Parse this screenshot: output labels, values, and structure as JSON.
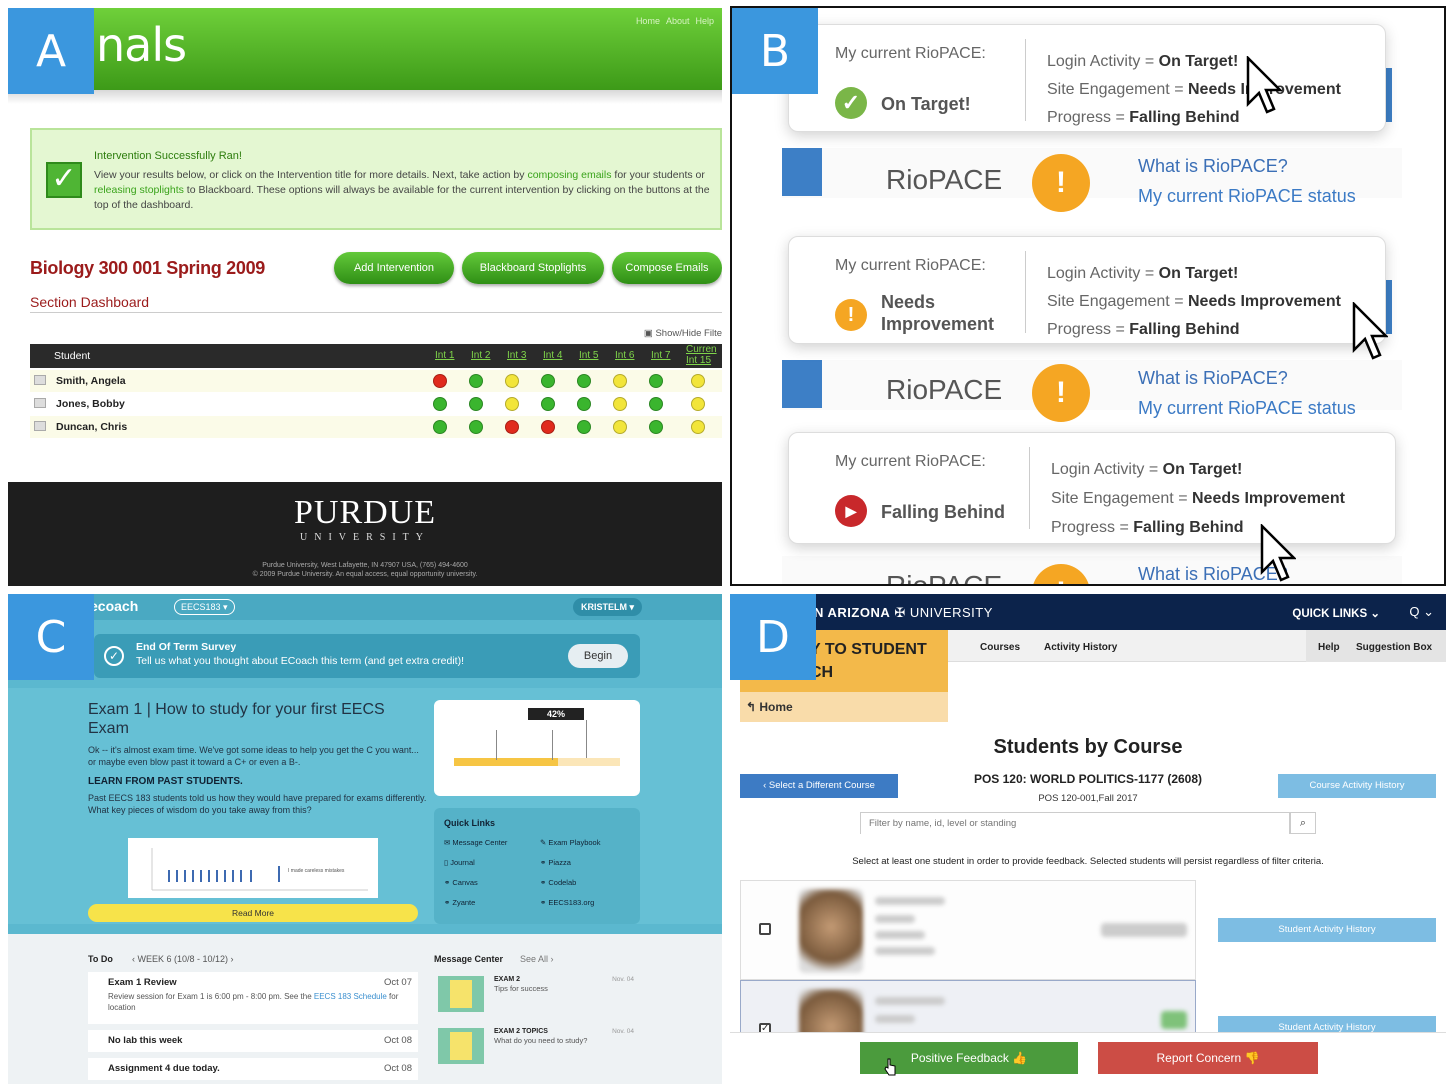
{
  "panel_labels": {
    "a": "A",
    "b": "B",
    "c": "C",
    "d": "D"
  },
  "panel_a": {
    "logo": "nals",
    "topnav": [
      "Home",
      "About",
      "Help"
    ],
    "notice_title": "Intervention Successfully Ran!",
    "notice_pre1": "View your results below, or click on the Intervention title for more details. Next, take action by ",
    "notice_link1": "composing emails",
    "notice_mid": " for your students or ",
    "notice_link2": "releasing stoplights",
    "notice_post": " to Blackboard. These options will always be available for the current intervention by clicking on the buttons at the top of the dashboard.",
    "course_title": "Biology 300 001 Spring 2009",
    "buttons": [
      "Add Intervention",
      "Blackboard Stoplights",
      "Compose Emails"
    ],
    "section": "Section Dashboard",
    "show_hide": "Show/Hide Filte",
    "table_header_student": "Student",
    "interventions": [
      "Int 1",
      "Int 2",
      "Int 3",
      "Int 4",
      "Int 5",
      "Int 6",
      "Int 7"
    ],
    "current_col": [
      "Curren",
      "Int 15"
    ],
    "students": [
      {
        "name": "Smith, Angela",
        "lights": [
          "red",
          "green",
          "yellow",
          "green",
          "green",
          "yellow",
          "green",
          "yellow"
        ]
      },
      {
        "name": "Jones, Bobby",
        "lights": [
          "green",
          "green",
          "yellow",
          "green",
          "green",
          "yellow",
          "green",
          "yellow"
        ]
      },
      {
        "name": "Duncan, Chris",
        "lights": [
          "green",
          "green",
          "red",
          "red",
          "green",
          "yellow",
          "green",
          "yellow"
        ]
      }
    ],
    "footer_logo": "PURDUE",
    "footer_univ": "UNIVERSITY",
    "footer_line1": "Purdue University, West Lafayette, IN 47907 USA, (765) 494-4600",
    "footer_line2": "© 2009 Purdue University. An equal access, equal opportunity university.",
    "colors": {
      "red": "#e02a1d",
      "green": "#3ab52e",
      "yellow": "#f2e53a"
    }
  },
  "panel_b": {
    "current_label": "My current RioPACE:",
    "bg_title": "RioPACE",
    "bg_what": "What is RioPACE?",
    "bg_status": "My current RioPACE status",
    "cards": [
      {
        "status": "On Target!",
        "icon": "check-icon",
        "login_l": "Login Activity = ",
        "login_v": "On Target!",
        "eng_l": "Site Engagement = ",
        "eng_v": "Needs Improvement",
        "prog_l": "Progress = ",
        "prog_v": "Falling Behind"
      },
      {
        "status": "Needs Improvement",
        "status_l1": "Needs",
        "status_l2": "Improvement",
        "icon": "warning-icon",
        "login_l": "Login Activity = ",
        "login_v": "On Target!",
        "eng_l": "Site Engagement = ",
        "eng_v": "Needs Improvement",
        "prog_l": "Progress = ",
        "prog_v": "Falling Behind"
      },
      {
        "status": "Falling Behind",
        "icon": "play-icon",
        "login_l": "Login Activity = ",
        "login_v": "On Target!",
        "eng_l": "Site Engagement = ",
        "eng_v": "Needs Improvement",
        "prog_l": "Progress = ",
        "prog_v": "Falling Behind"
      }
    ],
    "colors": {
      "on_target": "#7ab648",
      "needs_improvement": "#f5a623",
      "falling_behind": "#c8282b"
    }
  },
  "panel_c": {
    "brand": "ecoach",
    "course_badge": "EECS183 ▾",
    "user_badge": "KRISTELM ▾",
    "survey_title": "End Of Term Survey",
    "survey_body": "Tell us what you thought about ECoach this term (and get extra credit)!",
    "begin": "Begin",
    "exam_title": "Exam 1 | How to study for your first EECS Exam",
    "intro": "Ok -- it's almost exam time. We've got some ideas to help you get the C you want... or maybe even blow past it toward a C+ or even a B-.",
    "learn_title": "LEARN FROM PAST STUDENTS.",
    "learn_body": "Past EECS 183 students told us how they would have prepared for exams differently. What key pieces of wisdom do you take away from this?",
    "chart_caption": "I made careless mistakes",
    "read_more": "Read More",
    "grade_pct": "42%",
    "quick_links_title": "Quick Links",
    "quick_links": [
      "Message Center",
      "Exam Playbook",
      "Journal",
      "Piazza",
      "Canvas",
      "Codelab",
      "Zyante",
      "EECS183.org"
    ],
    "todo_title": "To Do",
    "week": "‹  WEEK 6 (10/8 - 10/12) ›",
    "todos": [
      {
        "title": "Exam 1 Review",
        "date": "Oct 07",
        "desc_pre": "Review session for Exam 1 is 6:00 pm - 8:00 pm. See the ",
        "desc_link": "EECS 183 Schedule",
        "desc_post": " for location"
      },
      {
        "title": "No lab this week",
        "date": "Oct 08"
      },
      {
        "title": "Assignment 4 due today.",
        "date": "Oct 08"
      }
    ],
    "message_center": "Message Center",
    "see_all": "See All ›",
    "messages": [
      {
        "title": "EXAM 2",
        "body": "Tips for success",
        "date": "Nov. 04"
      },
      {
        "title": "EXAM 2 TOPICS",
        "body": "What do you need to study?",
        "date": "Nov. 04"
      }
    ]
  },
  "panel_d": {
    "uni_prefix": "N ARIZONA",
    "uni_suffix": "UNIVERSITY",
    "quick_links": "QUICK LINKS ⌄",
    "search": "Q ⌄",
    "app_title_l1": "Y TO STUDENT",
    "app_title_l2": "CH",
    "home": "↰ Home",
    "subnav": [
      "Courses",
      "Activity History"
    ],
    "help": "Help",
    "suggestion": "Suggestion Box",
    "page_title": "Students by Course",
    "course": "POS 120: WORLD POLITICS-1177 (2608)",
    "course_sub": "POS 120-001,Fall 2017",
    "select_course": "‹  Select a Different Course",
    "course_activity": "Course Activity History",
    "filter_placeholder": "Filter by name, id, level or standing",
    "note": "Select at least one student in order to provide feedback. Selected students will persist regardless of filter criteria.",
    "student_activity": "Student Activity History",
    "positive": "Positive Feedback  👍",
    "concern": "Report Concern  👎"
  }
}
